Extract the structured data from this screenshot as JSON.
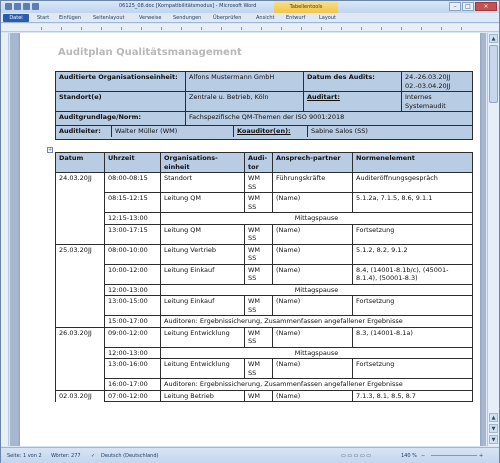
{
  "window": {
    "title": "06125_08.doc [Kompatibilitätsmodus] - Microsoft Word",
    "context_tab": "Tabellentools"
  },
  "ribbon": {
    "tabs": [
      "Datei",
      "Start",
      "Einfügen",
      "Seitenlayout",
      "Verweise",
      "Sendungen",
      "Überprüfen",
      "Ansicht",
      "Entwurf",
      "Layout"
    ]
  },
  "doc": {
    "heading": "Auditplan  Qualitätsmanagement",
    "info": {
      "org_label": "Auditierte Organisationseinheit:",
      "org_value": "Alfons Mustermann GmbH",
      "date_label": "Datum des Audits:",
      "date_value": "24.-26.03.20JJ 02.-03.04.20JJ",
      "site_label": "Standort(e)",
      "site_value": "Zentrale u. Betrieb, Köln",
      "type_label": "Auditart:",
      "type_value": "Internes Systemaudit",
      "basis_label": "Auditgrundlage/Norm:",
      "basis_value": "Fachspezifische QM-Themen der ISO 9001:2018",
      "lead_label": "Auditleiter:",
      "lead_value": "Walter Müller (WM)",
      "co_label": "Koauditor(en):",
      "co_value": "Sabine Salos (SS)"
    },
    "schedule": {
      "headers": [
        "Datum",
        "Uhrzeit",
        "Organisations-einheit",
        "Audi-tor",
        "Ansprech-partner",
        "Normenelement"
      ],
      "rows": [
        {
          "date": "24.03.20JJ",
          "time": "08:00-08:15",
          "unit": "Standort",
          "auditor": "WM SS",
          "contact": "Führungskräfte",
          "norm": "Auditeröffnungsgespräch"
        },
        {
          "date": "",
          "time": "08:15-12:15",
          "unit": "Leitung QM",
          "auditor": "WM SS",
          "contact": "(Name)",
          "norm": "5.1.2a, 7.1.5, 8.6, 9.1.1"
        },
        {
          "date": "",
          "time": "12:15-13:00",
          "span": "Mittagspause"
        },
        {
          "date": "",
          "time": "13:00-17:15",
          "unit": "Leitung QM",
          "auditor": "WM SS",
          "contact": "(Name)",
          "norm": "Fortsetzung"
        },
        {
          "date": "25.03.20JJ",
          "time": "08:00-10:00",
          "unit": "Leitung Vertrieb",
          "auditor": "WM SS",
          "contact": "(Name)",
          "norm": "5.1.2, 8.2, 9.1.2"
        },
        {
          "date": "",
          "time": "10:00-12:00",
          "unit": "Leitung Einkauf",
          "auditor": "WM SS",
          "contact": "(Name)",
          "norm": "8.4, (14001-8.1b/c), (45001-8.1.4), (50001-8.3)"
        },
        {
          "date": "",
          "time": "12:00-13:00",
          "span": "Mittagspause"
        },
        {
          "date": "",
          "time": "13:00-15:00",
          "unit": "Leitung Einkauf",
          "auditor": "WM SS",
          "contact": "(Name)",
          "norm": "Fortsetzung"
        },
        {
          "date": "",
          "time": "15:00-17:00",
          "span": "Auditoren: Ergebnissicherung, Zusammenfassen angefallener Ergebnisse"
        },
        {
          "date": "26.03.20JJ",
          "time": "09:00-12:00",
          "unit": "Leitung Entwicklung",
          "auditor": "WM SS",
          "contact": "(Name)",
          "norm": "8.3, (14001-8.1a)"
        },
        {
          "date": "",
          "time": "12:00-13:00",
          "span": "Mittagspause"
        },
        {
          "date": "",
          "time": "13:00-16:00",
          "unit": "Leitung Entwicklung",
          "auditor": "WM SS",
          "contact": "(Name)",
          "norm": "Fortsetzung"
        },
        {
          "date": "",
          "time": "16:00-17:00",
          "span": "Auditoren: Ergebnissicherung, Zusammenfassen angefallener Ergebnisse"
        },
        {
          "date": "02.03.20JJ",
          "time": "07:00-12:00",
          "unit": "Leitung Betrieb",
          "auditor": "WM",
          "contact": "(Name)",
          "norm": "7.1.3, 8.1, 8.5, 8.7"
        }
      ]
    }
  },
  "status": {
    "page": "Seite: 1 von 2",
    "words": "Wörter: 277",
    "language": "Deutsch (Deutschland)",
    "zoom": "140 %"
  }
}
